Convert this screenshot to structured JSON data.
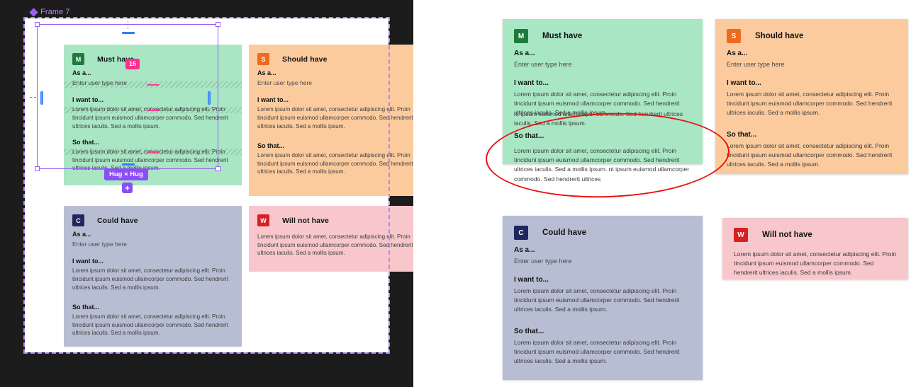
{
  "canvas": {
    "frame_label": "Frame 7",
    "frame_icon": "diamond-component-icon",
    "spacing_badge": "16",
    "hug_badge": "Hug × Hug",
    "add_button": "+"
  },
  "strings": {
    "as_a_label": "As a...",
    "as_a_placeholder": "Enter user type here",
    "i_want_to_label": "I want to...",
    "so_that_label": "So that...",
    "lorem": "Lorem ipsum dolor sit amet, consectetur adipiscing elit. Proin tincidunt ipsum euismod ullamcorper commodo. Sed hendrerit ultrices iaculis. Sed a mollis ipsum.",
    "lorem_overflow_tail": "nt ipsum euismod ullamcorper commodo. Sed hendrerit ultrices iaculis. Sed a mollis ipsum.",
    "lorem_clipped": "Lorem ipsum dolor sit amet, consectetur adipiscing elit. Proin tincidunt ipsum euismod ullamcorper commodo. Sed hendrerit ultrices iaculis. Sed a mollis ipsum. nt ipsum euismod ullamcorper commodo. Sed hendrerit ultrices"
  },
  "cards": {
    "must": {
      "key": "M",
      "title": "Must have",
      "color": "#a8e6c4",
      "badge_color": "#1e7a3c"
    },
    "should": {
      "key": "S",
      "title": "Should have",
      "color": "#fbcb9e",
      "badge_color": "#ed6a1f"
    },
    "could": {
      "key": "C",
      "title": "Could have",
      "color": "#b7bdd3",
      "badge_color": "#22265e"
    },
    "will": {
      "key": "W",
      "title": "Will not have",
      "color": "#f7c7cb",
      "badge_color": "#d81f22"
    }
  },
  "annotation": {
    "shape": "red-ellipse-highlight",
    "color": "#e8120f"
  },
  "accent": {
    "selection": "#9b5df2",
    "spacing": "#ff2d8e",
    "blue_guide": "#2f7bfd"
  }
}
